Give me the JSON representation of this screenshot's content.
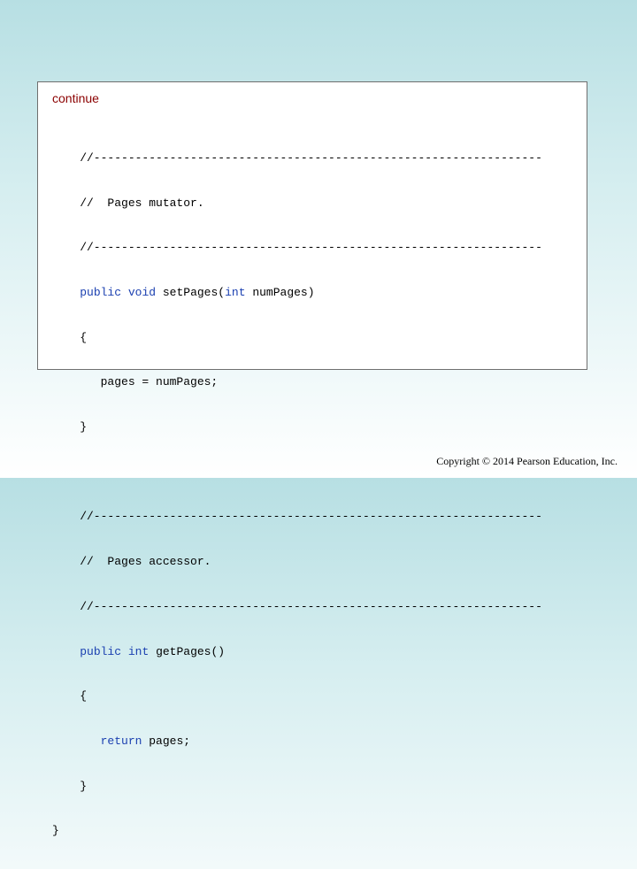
{
  "slide": {
    "continue_label": "continue",
    "copyright": "Copyright © 2014 Pearson Education, Inc."
  },
  "code": {
    "mutator_block": {
      "rule_top": "    //-----------------------------------------------------------------",
      "comment": "    //  Pages mutator.",
      "rule_bottom": "    //-----------------------------------------------------------------",
      "sig_indent": "    ",
      "kw_public": "public",
      "kw_void": "void",
      "method_name": "setPages(",
      "kw_int": "int",
      "param": "numPages)",
      "open_brace": "    {",
      "body": "       pages = numPages;",
      "close_brace": "    }"
    },
    "accessor_block": {
      "rule_top": "    //-----------------------------------------------------------------",
      "comment": "    //  Pages accessor.",
      "rule_bottom": "    //-----------------------------------------------------------------",
      "sig_indent": "    ",
      "kw_public": "public",
      "kw_int": "int",
      "method_name": "getPages()",
      "open_brace": "    {",
      "body_indent": "       ",
      "kw_return": "return",
      "body_rest": "pages;",
      "close_brace": "    }"
    },
    "class_close": "}"
  }
}
